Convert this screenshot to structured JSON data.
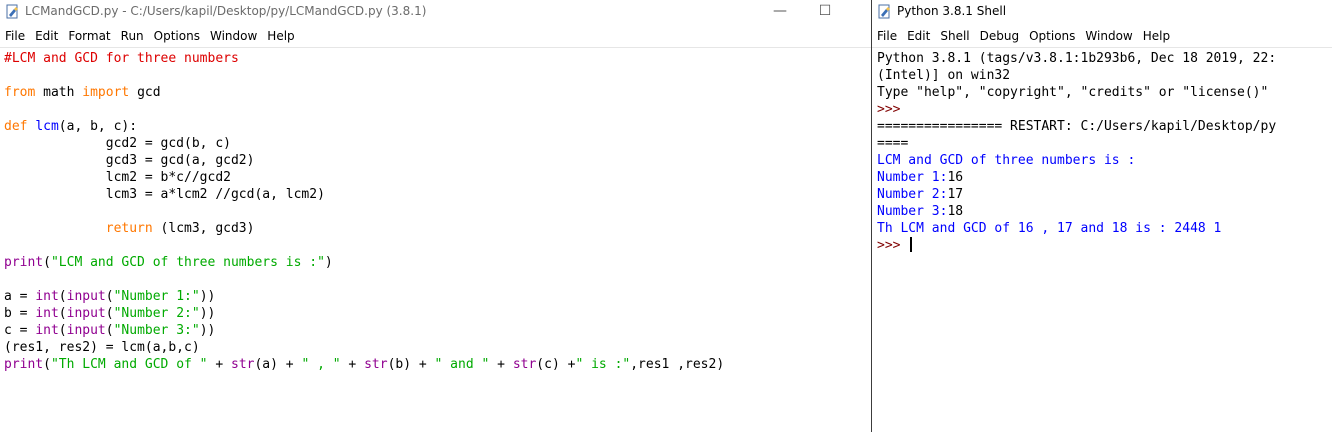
{
  "editor": {
    "title": "LCMandGCD.py - C:/Users/kapil/Desktop/py/LCMandGCD.py (3.8.1)",
    "menu": [
      "File",
      "Edit",
      "Format",
      "Run",
      "Options",
      "Window",
      "Help"
    ],
    "controls": {
      "minimize": "—",
      "maximize": "☐"
    },
    "lines": [
      [
        {
          "t": "#LCM and GCD for three numbers",
          "c": "cm"
        }
      ],
      [],
      [
        {
          "t": "from",
          "c": "kw"
        },
        {
          "t": " math "
        },
        {
          "t": "import",
          "c": "kw"
        },
        {
          "t": " gcd"
        }
      ],
      [],
      [
        {
          "t": "def",
          "c": "kw"
        },
        {
          "t": " "
        },
        {
          "t": "lcm",
          "c": "def"
        },
        {
          "t": "(a, b, c):"
        }
      ],
      [
        {
          "t": "             gcd2 = gcd(b, c)"
        }
      ],
      [
        {
          "t": "             gcd3 = gcd(a, gcd2)"
        }
      ],
      [
        {
          "t": "             lcm2 = b*c//gcd2"
        }
      ],
      [
        {
          "t": "             lcm3 = a*lcm2 //gcd(a, lcm2)"
        }
      ],
      [],
      [
        {
          "t": "             "
        },
        {
          "t": "return",
          "c": "kw"
        },
        {
          "t": " (lcm3, gcd3)"
        }
      ],
      [],
      [
        {
          "t": "print",
          "c": "bi"
        },
        {
          "t": "("
        },
        {
          "t": "\"LCM and GCD of three numbers is :\"",
          "c": "str"
        },
        {
          "t": ")"
        }
      ],
      [],
      [
        {
          "t": "a = "
        },
        {
          "t": "int",
          "c": "bi"
        },
        {
          "t": "("
        },
        {
          "t": "input",
          "c": "bi"
        },
        {
          "t": "("
        },
        {
          "t": "\"Number 1:\"",
          "c": "str"
        },
        {
          "t": "))"
        }
      ],
      [
        {
          "t": "b = "
        },
        {
          "t": "int",
          "c": "bi"
        },
        {
          "t": "("
        },
        {
          "t": "input",
          "c": "bi"
        },
        {
          "t": "("
        },
        {
          "t": "\"Number 2:\"",
          "c": "str"
        },
        {
          "t": "))"
        }
      ],
      [
        {
          "t": "c = "
        },
        {
          "t": "int",
          "c": "bi"
        },
        {
          "t": "("
        },
        {
          "t": "input",
          "c": "bi"
        },
        {
          "t": "("
        },
        {
          "t": "\"Number 3:\"",
          "c": "str"
        },
        {
          "t": "))"
        }
      ],
      [
        {
          "t": "(res1, res2) = lcm(a,b,c)"
        }
      ],
      [
        {
          "t": "print",
          "c": "bi"
        },
        {
          "t": "("
        },
        {
          "t": "\"Th LCM and GCD of \"",
          "c": "str"
        },
        {
          "t": " + "
        },
        {
          "t": "str",
          "c": "bi"
        },
        {
          "t": "(a) + "
        },
        {
          "t": "\" , \"",
          "c": "str"
        },
        {
          "t": " + "
        },
        {
          "t": "str",
          "c": "bi"
        },
        {
          "t": "(b) + "
        },
        {
          "t": "\" and \"",
          "c": "str"
        },
        {
          "t": " + "
        },
        {
          "t": "str",
          "c": "bi"
        },
        {
          "t": "(c) +"
        },
        {
          "t": "\" is :\"",
          "c": "str"
        },
        {
          "t": ",res1 ,res2)"
        }
      ]
    ]
  },
  "shell": {
    "title": "Python 3.8.1 Shell",
    "menu": [
      "File",
      "Edit",
      "Shell",
      "Debug",
      "Options",
      "Window",
      "Help"
    ],
    "lines": [
      [
        {
          "t": "Python 3.8.1 (tags/v3.8.1:1b293b6, Dec 18 2019, 22:"
        }
      ],
      [
        {
          "t": "(Intel)] on win32"
        }
      ],
      [
        {
          "t": "Type \"help\", \"copyright\", \"credits\" or \"license()\""
        }
      ],
      [
        {
          "t": ">>>",
          "c": "prompt"
        }
      ],
      [
        {
          "t": "================ RESTART: C:/Users/kapil/Desktop/py"
        }
      ],
      [
        {
          "t": "===="
        }
      ],
      [
        {
          "t": "LCM and GCD of three numbers is :",
          "c": "out"
        }
      ],
      [
        {
          "t": "Number 1:",
          "c": "out"
        },
        {
          "t": "16"
        }
      ],
      [
        {
          "t": "Number 2:",
          "c": "out"
        },
        {
          "t": "17"
        }
      ],
      [
        {
          "t": "Number 3:",
          "c": "out"
        },
        {
          "t": "18"
        }
      ],
      [
        {
          "t": "Th LCM and GCD of 16 , 17 and 18 is : 2448 1",
          "c": "out"
        }
      ],
      [
        {
          "t": ">>> ",
          "c": "prompt"
        }
      ]
    ]
  }
}
